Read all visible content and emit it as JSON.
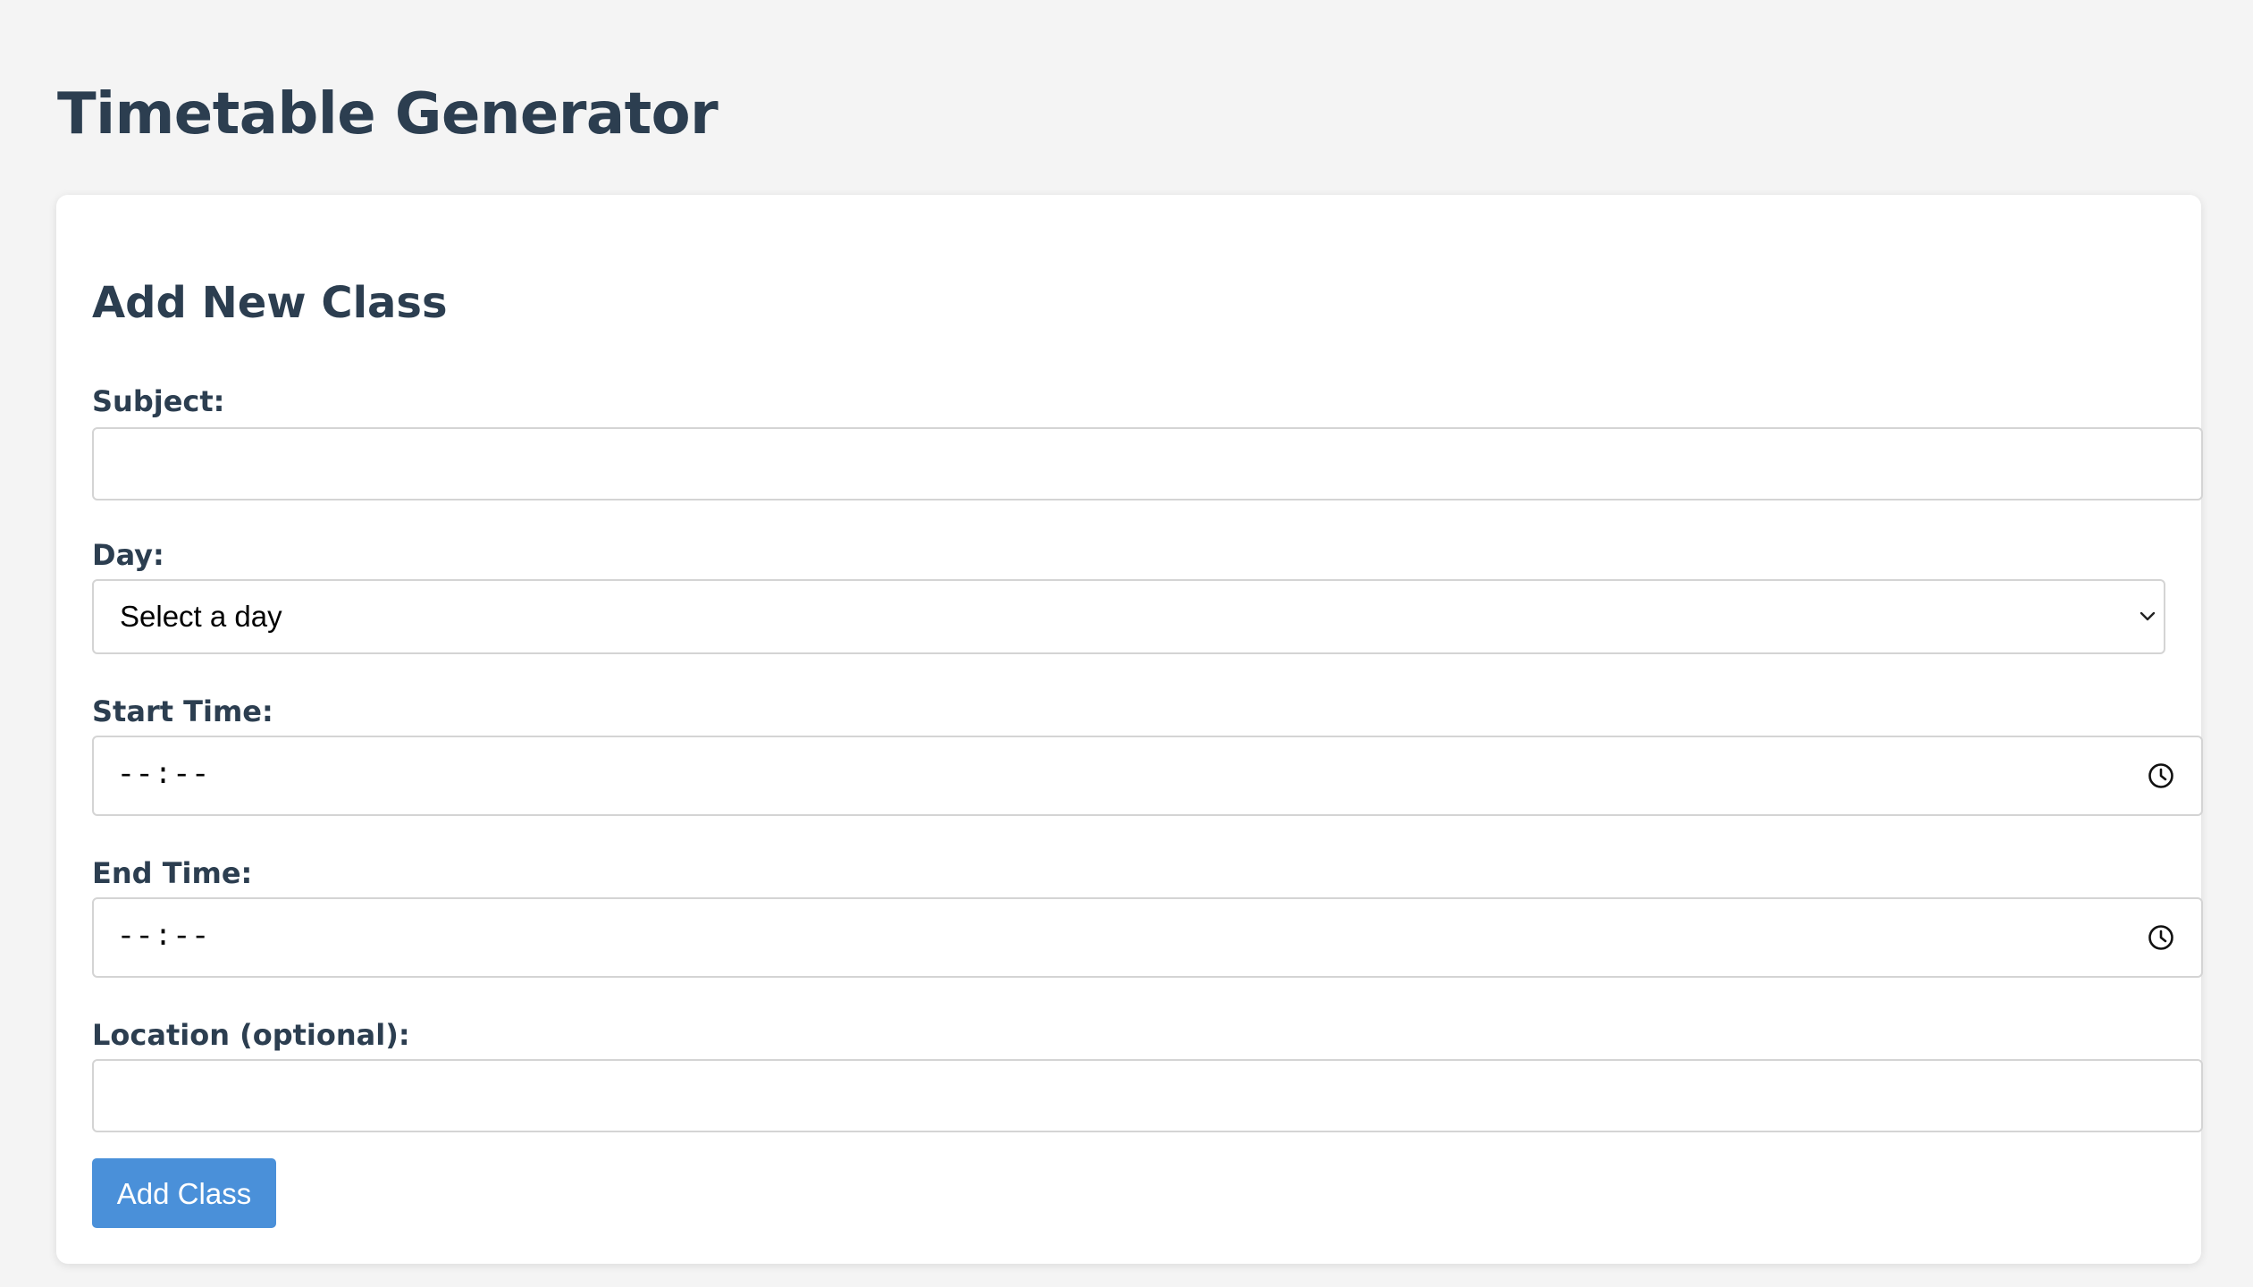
{
  "page": {
    "title": "Timetable Generator"
  },
  "form": {
    "section_title": "Add New Class",
    "subject": {
      "label": "Subject:",
      "value": "",
      "placeholder": ""
    },
    "day": {
      "label": "Day:",
      "selected": "Select a day"
    },
    "start_time": {
      "label": "Start Time:",
      "value": "--:--"
    },
    "end_time": {
      "label": "End Time:",
      "value": "--:--"
    },
    "location": {
      "label": "Location (optional):",
      "value": "",
      "placeholder": ""
    },
    "submit_label": "Add Class"
  },
  "colors": {
    "heading": "#2c3e50",
    "background": "#f4f4f4",
    "button": "#4a90d9"
  },
  "icons": {
    "select": "chevron-down-icon",
    "time": "clock-icon"
  }
}
